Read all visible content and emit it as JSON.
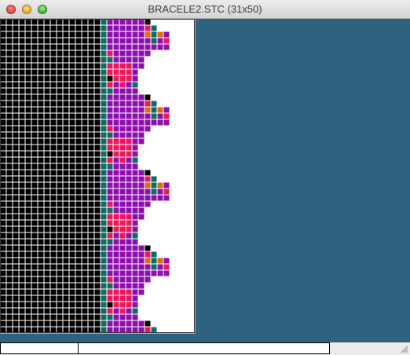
{
  "window": {
    "title": "BRACELE2.STC (31x50)"
  },
  "pattern": {
    "columns": 31,
    "rows": 50,
    "colors": {
      "grid_line": "#ffffff",
      "empty": "#ffffff",
      "black": "#000000",
      "teal": "#0f6b63",
      "orange": "#e06a14",
      "red": "#f0145a",
      "purple": "#8e0fae",
      "outline": "#3a3a3a"
    }
  },
  "statusbar": {
    "cell1": "",
    "cell2": "",
    "cell3": ""
  }
}
